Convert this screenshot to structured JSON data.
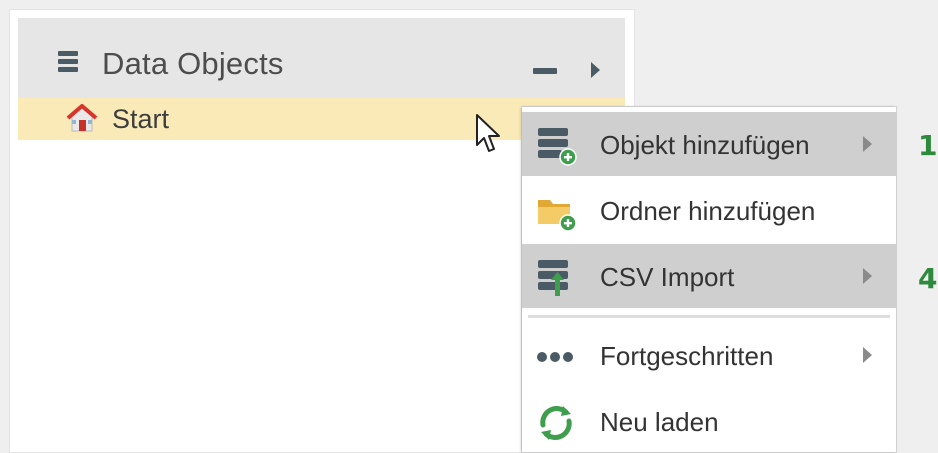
{
  "panel": {
    "title": "Data Objects",
    "title_icon": "list-icon",
    "collapse_icon": "minus-icon",
    "expand_icon": "arrow-right-icon"
  },
  "tree": {
    "items": [
      {
        "label": "Start",
        "icon": "home-icon",
        "selected": true
      }
    ]
  },
  "context_menu": {
    "items": [
      {
        "label": "Objekt hinzufügen",
        "icon": "add-object-icon",
        "has_submenu": true,
        "highlighted": true
      },
      {
        "label": "Ordner hinzufügen",
        "icon": "add-folder-icon",
        "has_submenu": false,
        "highlighted": false
      },
      {
        "label": "CSV Import",
        "icon": "csv-import-icon",
        "has_submenu": true,
        "highlighted": true
      },
      {
        "label": "Fortgeschritten",
        "icon": "more-icon",
        "has_submenu": true,
        "highlighted": false
      },
      {
        "label": "Neu laden",
        "icon": "reload-icon",
        "has_submenu": false,
        "highlighted": false
      }
    ]
  },
  "callouts": [
    "1",
    "4"
  ],
  "colors": {
    "header_bg": "#e6e6e6",
    "selected_row": "#faeab8",
    "menu_highlight": "#cfcfcf",
    "accent_green": "#2d8a3c",
    "folder_yellow": "#f2c45a",
    "icon_slate": "#4b5b66"
  }
}
